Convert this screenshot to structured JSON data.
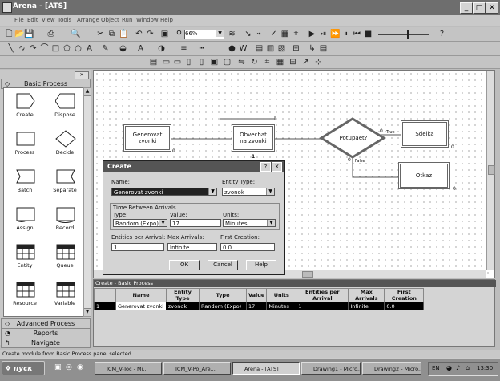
{
  "window": {
    "title": "Arena - [ATS]",
    "min": "_",
    "max": "□",
    "close": "✕"
  },
  "menu": [
    "File",
    "Edit",
    "View",
    "Tools",
    "Arrange",
    "Object",
    "Run",
    "Window",
    "Help"
  ],
  "toolbar": {
    "zoom": "66%"
  },
  "panel": {
    "basic_header": "Basic Process",
    "modules": [
      {
        "label": "Create",
        "icon": "create-shape"
      },
      {
        "label": "Dispose",
        "icon": "dispose-shape"
      },
      {
        "label": "Process",
        "icon": "process-shape"
      },
      {
        "label": "Decide",
        "icon": "decide-shape"
      },
      {
        "label": "Batch",
        "icon": "batch-shape"
      },
      {
        "label": "Separate",
        "icon": "separate-shape"
      },
      {
        "label": "Assign",
        "icon": "assign-shape"
      },
      {
        "label": "Record",
        "icon": "record-shape"
      },
      {
        "label": "Entity",
        "icon": "table-grid"
      },
      {
        "label": "Queue",
        "icon": "table-grid"
      },
      {
        "label": "Resource",
        "icon": "table-grid"
      },
      {
        "label": "Variable",
        "icon": "table-grid"
      }
    ],
    "advanced": "Advanced Process",
    "reports": "Reports",
    "navigate": "Navigate"
  },
  "flow": {
    "create_label": "Generovat zvonki",
    "process_label": "Obvechat na zvonki",
    "decide_label": "Potupaet?",
    "dispose1_label": "Sdelka",
    "dispose2_label": "Otkaz",
    "true_label": "True",
    "false_label": "False",
    "count0": "0",
    "count_process": "1",
    "count_decide": "0",
    "count_dispose1": "0",
    "count_dispose2": "0"
  },
  "dialog": {
    "title": "Create",
    "help_btn": "?",
    "close_btn": "X",
    "name_label": "Name:",
    "name_value": "Generovat zvonki",
    "entity_type_label": "Entity Type:",
    "entity_type_value": "zvonok",
    "tba_group": "Time Between Arrivals",
    "type_label": "Type:",
    "type_value": "Random (Expo)",
    "value_label": "Value:",
    "value_value": "17",
    "units_label": "Units:",
    "units_value": "Minutes",
    "epa_label": "Entities per Arrival:",
    "epa_value": "1",
    "max_label": "Max Arrivals:",
    "max_value": "Infinite",
    "first_label": "First Creation:",
    "first_value": "0.0",
    "ok": "OK",
    "cancel": "Cancel",
    "help": "Help"
  },
  "sheet": {
    "title": "Create - Basic Process",
    "headers": [
      "Name",
      "Entity Type",
      "Type",
      "Value",
      "Units",
      "Entities per Arrival",
      "Max Arrivals",
      "First Creation"
    ],
    "row": {
      "num": "1",
      "cells": [
        "Generovat zvonki",
        "zvonok",
        "Random (Expo)",
        "17",
        "Minutes",
        "1",
        "Infinite",
        "0.0"
      ]
    }
  },
  "status": "Create module from Basic Process panel selected.",
  "taskbar": {
    "start": "пуск",
    "tasks": [
      "ICM_V-Toc - Mi...",
      "ICM_V-Po_Are...",
      "Arena - [ATS]",
      "Drawing1 - Micro...",
      "Drawing2 - Micro..."
    ],
    "lang": "EN",
    "clock": "13:30"
  }
}
